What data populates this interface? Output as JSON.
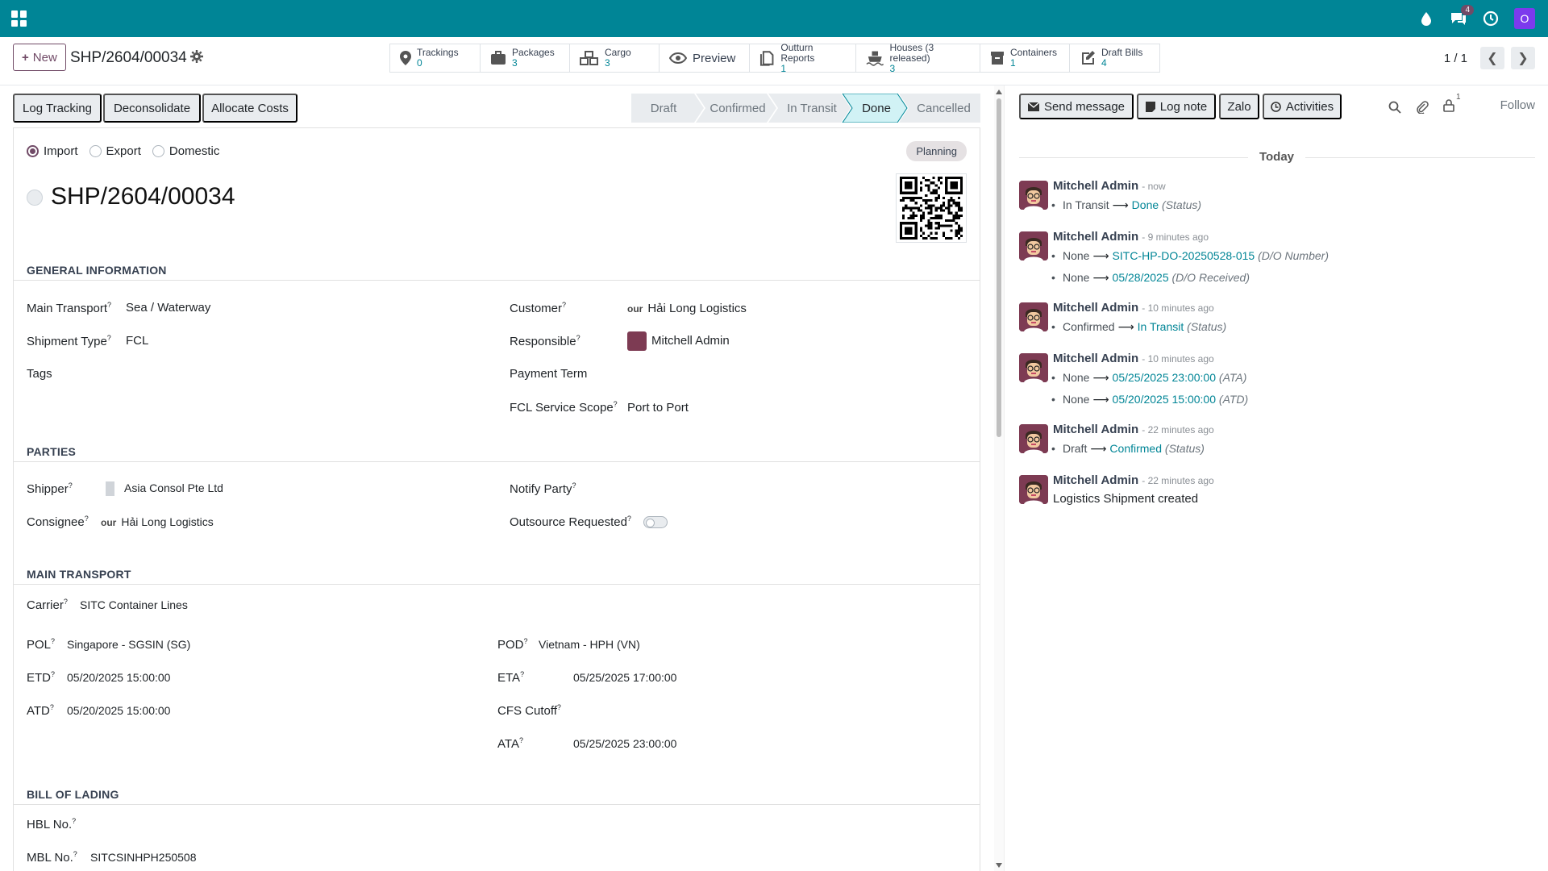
{
  "nav": {
    "chat_count": "4",
    "user_initial": "O"
  },
  "control": {
    "new_label": "New",
    "record_name": "SHP/2604/00034",
    "smart_buttons": [
      {
        "label": "Trackings",
        "count": "0"
      },
      {
        "label": "Packages",
        "count": "3"
      },
      {
        "label": "Cargo",
        "count": "3"
      },
      {
        "label": "Preview",
        "count": ""
      },
      {
        "label": "Outturn Reports",
        "count": "1"
      },
      {
        "label": "Houses (3 released)",
        "count": "3"
      },
      {
        "label": "Containers",
        "count": "1"
      },
      {
        "label": "Draft Bills",
        "count": "4"
      }
    ],
    "pager": "1 / 1"
  },
  "actions": [
    "Log Tracking",
    "Deconsolidate",
    "Allocate Costs"
  ],
  "stages": [
    "Draft",
    "Confirmed",
    "In Transit",
    "Done",
    "Cancelled"
  ],
  "current_stage": "Done",
  "form": {
    "direction": [
      "Import",
      "Export",
      "Domestic"
    ],
    "direction_selected": "Import",
    "planning_badge": "Planning",
    "title": "SHP/2604/00034",
    "general": {
      "heading": "GENERAL INFORMATION",
      "main_transport_label": "Main Transport",
      "main_transport": "Sea / Waterway",
      "shipment_type_label": "Shipment Type",
      "shipment_type": "FCL",
      "tags_label": "Tags",
      "customer_label": "Customer",
      "customer_prefix": "our",
      "customer": "Hải Long Logistics",
      "responsible_label": "Responsible",
      "responsible": "Mitchell Admin",
      "payment_term_label": "Payment Term",
      "fcl_scope_label": "FCL Service Scope",
      "fcl_scope": "Port to Port"
    },
    "parties": {
      "heading": "PARTIES",
      "shipper_label": "Shipper",
      "shipper": "Asia Consol Pte Ltd",
      "consignee_label": "Consignee",
      "consignee_prefix": "our",
      "consignee": "Hải Long Logistics",
      "notify_label": "Notify Party",
      "outsource_label": "Outsource Requested"
    },
    "transport": {
      "heading": "MAIN TRANSPORT",
      "carrier_label": "Carrier",
      "carrier": "SITC Container Lines",
      "pol_label": "POL",
      "pol": "Singapore - SGSIN (SG)",
      "etd_label": "ETD",
      "etd": "05/20/2025 15:00:00",
      "atd_label": "ATD",
      "atd": "05/20/2025 15:00:00",
      "pod_label": "POD",
      "pod": "Vietnam - HPH (VN)",
      "eta_label": "ETA",
      "eta": "05/25/2025 17:00:00",
      "cfs_label": "CFS Cutoff",
      "ata_label": "ATA",
      "ata": "05/25/2025 23:00:00"
    },
    "bol": {
      "heading": "BILL OF LADING",
      "hbl_label": "HBL No.",
      "mbl_label": "MBL No.",
      "mbl": "SITCSINHPH250508"
    },
    "help_mark": "?"
  },
  "chatter": {
    "send_message": "Send message",
    "log_note": "Log note",
    "zalo": "Zalo",
    "activities": "Activities",
    "followers_count": "1",
    "follow": "Follow",
    "today": "Today",
    "messages": [
      {
        "author": "Mitchell Admin",
        "time": "- now",
        "changes": [
          {
            "old": "In Transit",
            "new": "Done",
            "field": "(Status)"
          }
        ]
      },
      {
        "author": "Mitchell Admin",
        "time": "- 9 minutes ago",
        "changes": [
          {
            "old": "None",
            "new": "SITC-HP-DO-20250528-015",
            "field": "(D/O Number)"
          },
          {
            "old": "None",
            "new": "05/28/2025",
            "field": "(D/O Received)"
          }
        ]
      },
      {
        "author": "Mitchell Admin",
        "time": "- 10 minutes ago",
        "changes": [
          {
            "old": "Confirmed",
            "new": "In Transit",
            "field": "(Status)"
          }
        ]
      },
      {
        "author": "Mitchell Admin",
        "time": "- 10 minutes ago",
        "changes": [
          {
            "old": "None",
            "new": "05/25/2025 23:00:00",
            "field": "(ATA)"
          },
          {
            "old": "None",
            "new": "05/20/2025 15:00:00",
            "field": "(ATD)"
          }
        ]
      },
      {
        "author": "Mitchell Admin",
        "time": "- 22 minutes ago",
        "changes": [
          {
            "old": "Draft",
            "new": "Confirmed",
            "field": "(Status)"
          }
        ]
      },
      {
        "author": "Mitchell Admin",
        "time": "- 22 minutes ago",
        "body": "Logistics Shipment created"
      }
    ]
  },
  "colors": {
    "brand": "#008596",
    "accent": "#714b67"
  }
}
